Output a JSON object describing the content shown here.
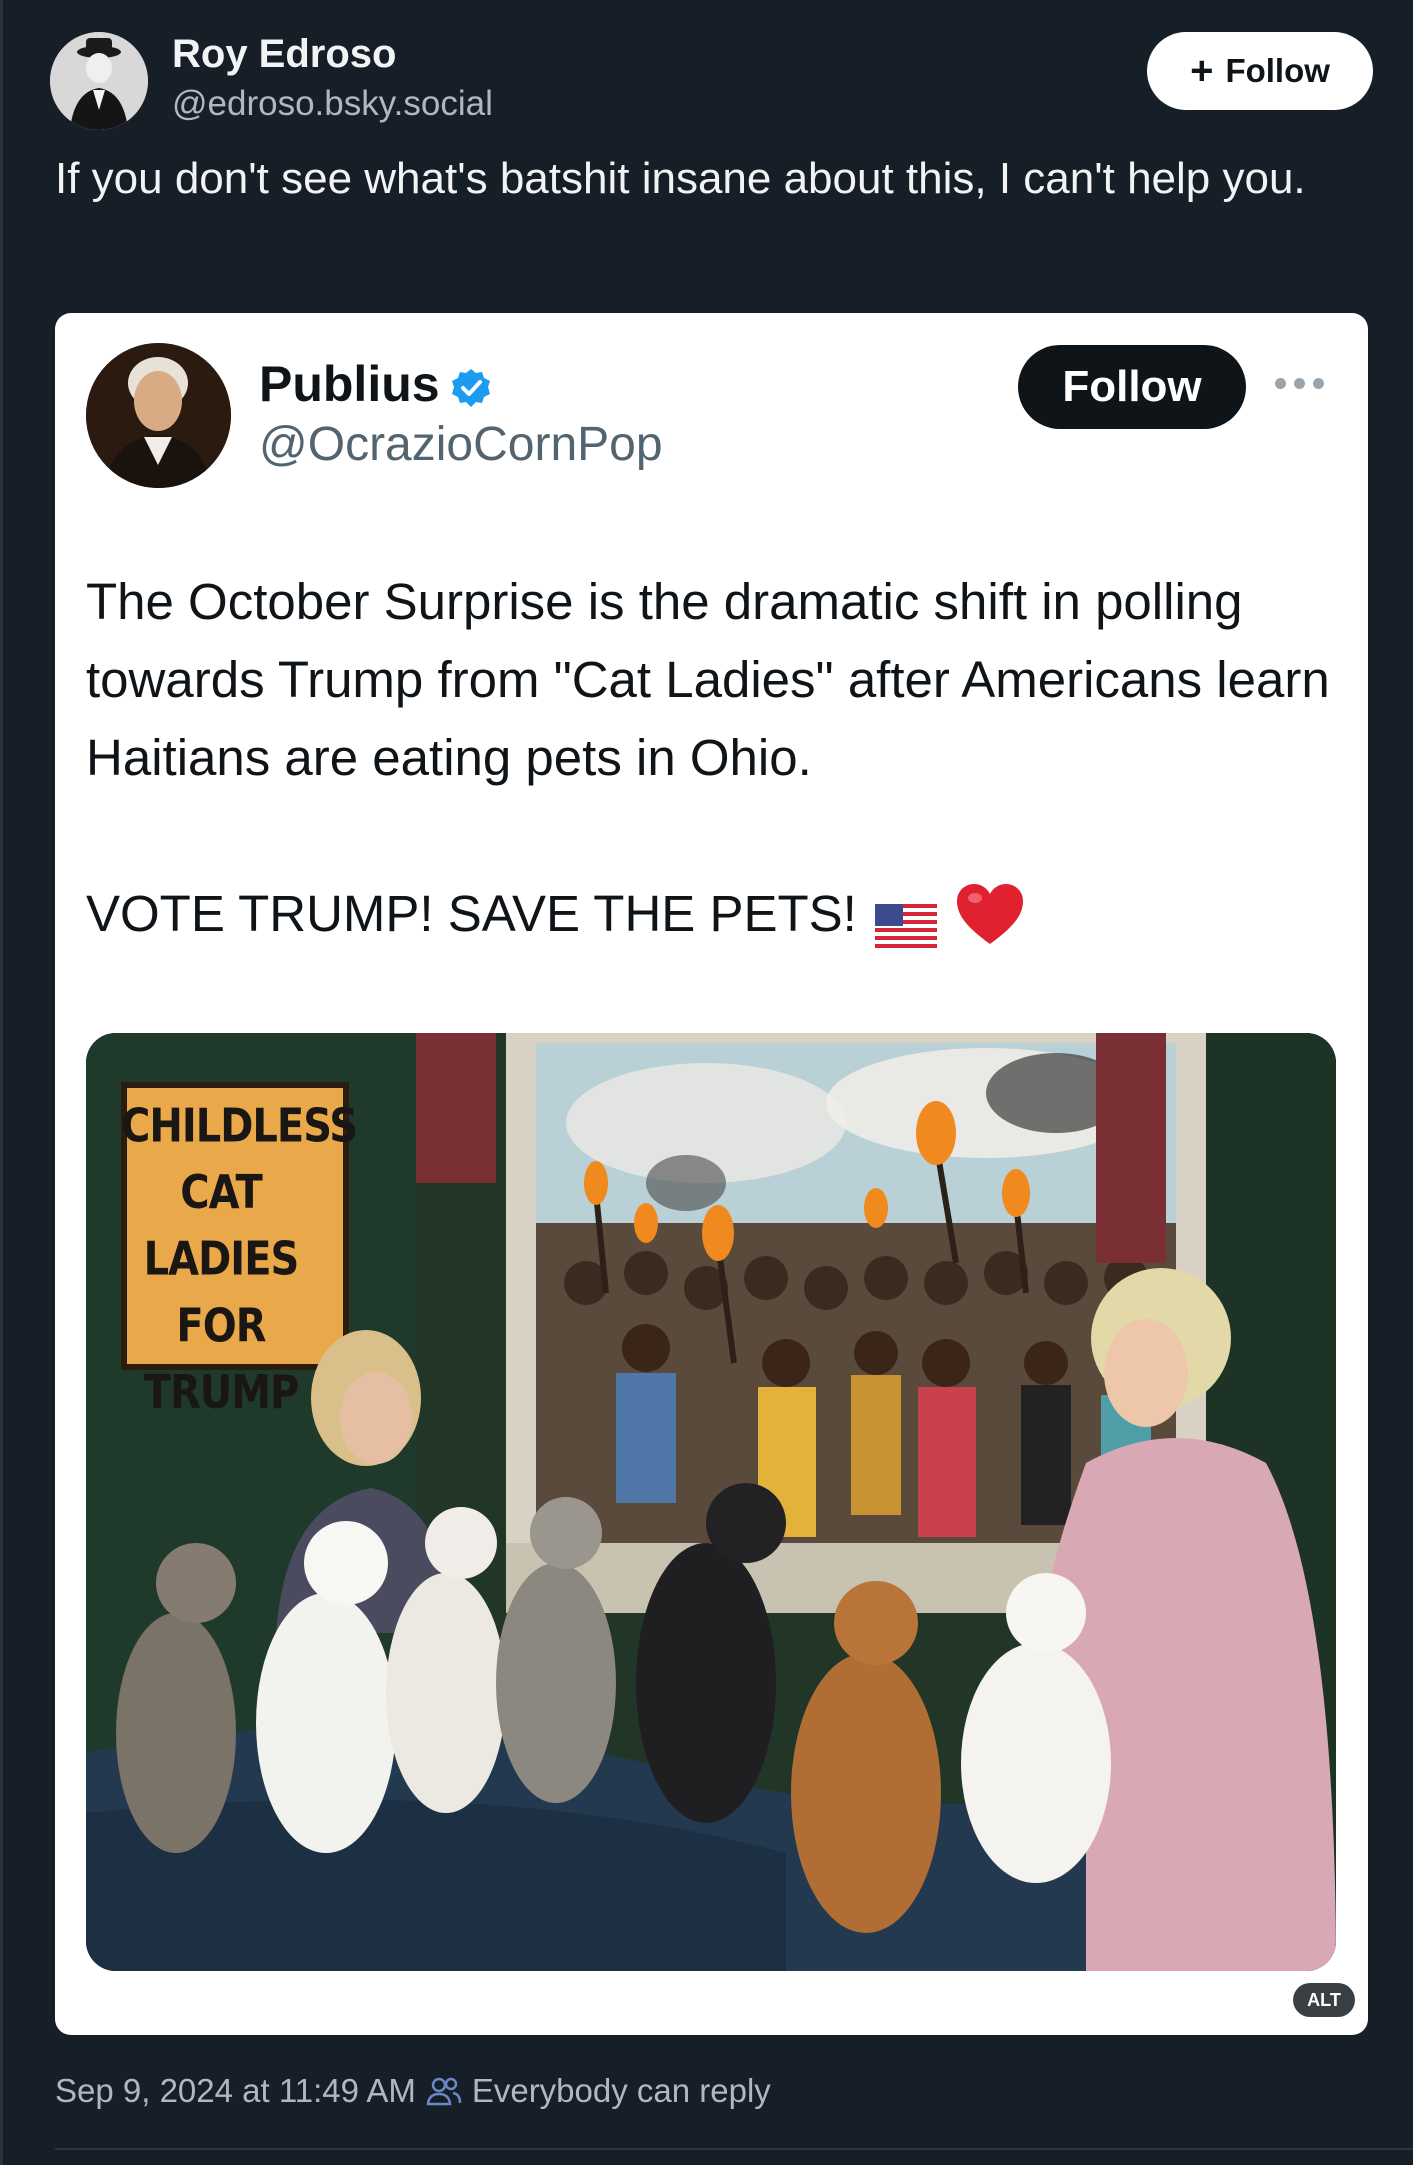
{
  "post": {
    "author": {
      "name": "Roy Edroso",
      "handle": "@edroso.bsky.social"
    },
    "follow_label": "Follow",
    "text": "If you don't see what's batshit insane about this, I can't help you.",
    "timestamp": "Sep 9, 2024 at 11:49 AM",
    "reply_setting": "Everybody can reply"
  },
  "embed": {
    "author": {
      "name": "Publius",
      "handle": "@OcrazioCornPop",
      "verified": true
    },
    "follow_label": "Follow",
    "text": "The October Surprise is the dramatic shift in polling towards Trump from \"Cat Ladies\" after Americans learn Haitians are eating pets in Ohio.",
    "cta": "VOTE TRUMP!  SAVE THE PETS!",
    "emoji": [
      "us-flag-icon",
      "red-heart-icon"
    ],
    "image": {
      "sign_lines": [
        "CHILDLESS",
        "CAT LADIES",
        "FOR",
        "TRUMP"
      ],
      "alt_badge": "ALT"
    }
  },
  "colors": {
    "background": "#161e27",
    "accent_verified": "#1d9bf0",
    "text_primary": "#f1f3f5",
    "text_secondary": "#aeb7c2"
  }
}
